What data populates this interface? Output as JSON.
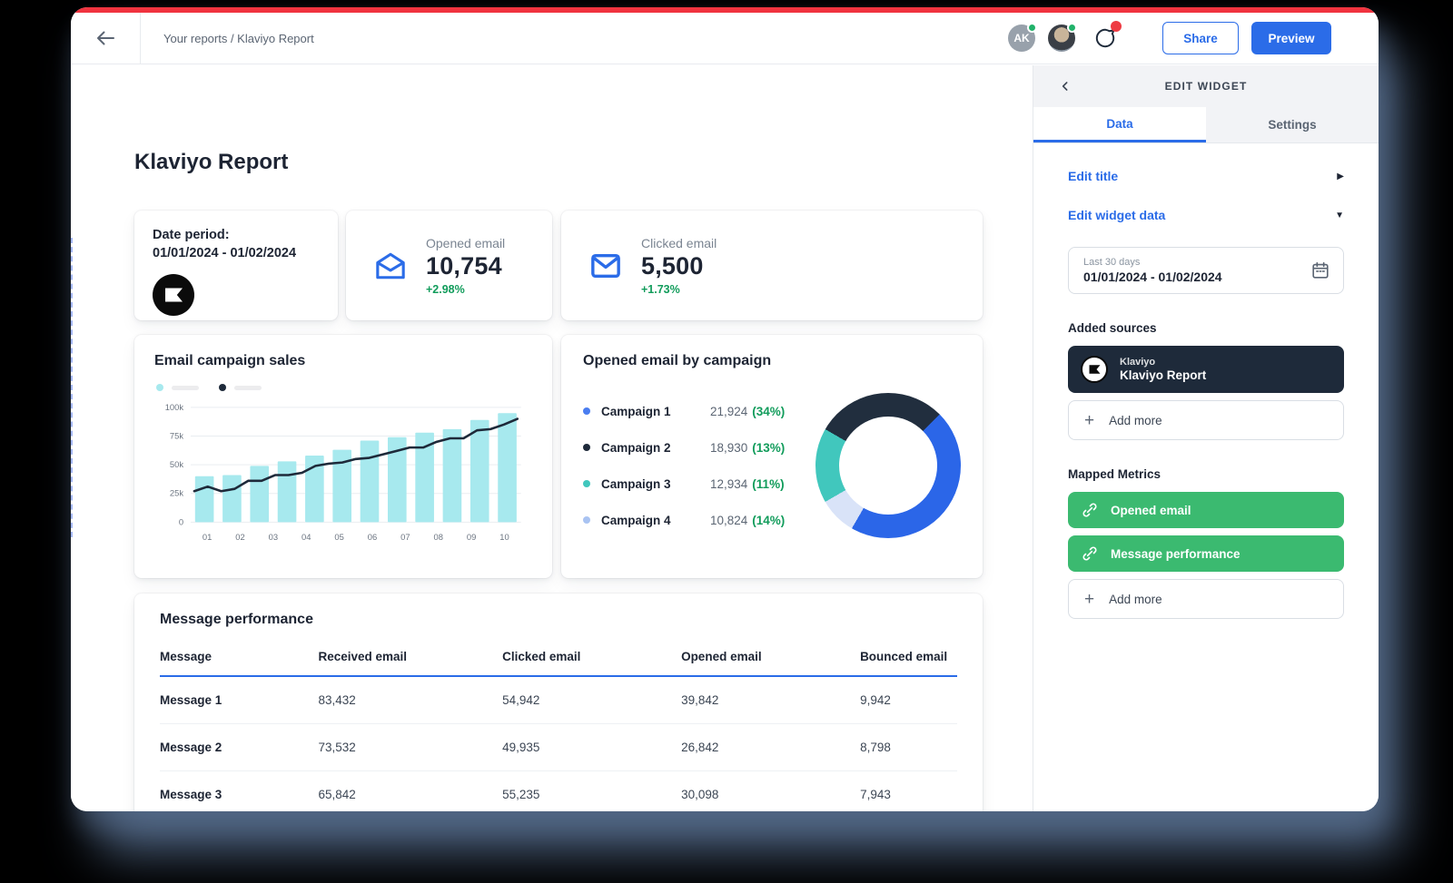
{
  "topbar": {
    "breadcrumb": "Your reports / Klaviyo Report",
    "avatar_initials": "AK",
    "share_label": "Share",
    "preview_label": "Preview"
  },
  "report": {
    "title": "Klaviyo Report",
    "date_card": {
      "label": "Date period:",
      "range": "01/01/2024 - 01/02/2024"
    },
    "kpis": [
      {
        "label": "Opened email",
        "value": "10,754",
        "delta": "+2.98%"
      },
      {
        "label": "Clicked email",
        "value": "5,500",
        "delta": "+1.73%"
      }
    ]
  },
  "chart_data": [
    {
      "type": "bar",
      "title": "Email campaign sales",
      "x_labels": [
        "01",
        "02",
        "03",
        "04",
        "05",
        "06",
        "07",
        "08",
        "09",
        "10"
      ],
      "bar_values_k": [
        40,
        41,
        49,
        53,
        58,
        63,
        71,
        74,
        78,
        81,
        89,
        95
      ],
      "line_values_k": [
        27,
        31,
        27,
        29,
        36,
        36,
        41,
        41,
        43,
        49,
        51,
        52,
        55,
        56,
        59,
        62,
        65,
        65,
        70,
        73,
        73,
        80,
        81,
        85,
        90
      ],
      "y_ticks": [
        "100k",
        "75k",
        "50k",
        "25k",
        "0"
      ],
      "ylim": [
        0,
        100
      ],
      "ylabel": "",
      "xlabel": "",
      "grid": "horizontal",
      "legend_position": "top-left-unlabeled",
      "bar_color": "#a7e9ee",
      "line_color": "#1e2a3a"
    },
    {
      "type": "pie",
      "title": "Opened email by campaign",
      "segments": [
        {
          "label": "Campaign 1",
          "value": "21,924",
          "pct": "(34%)",
          "dot_color": "#4a7df0"
        },
        {
          "label": "Campaign 2",
          "value": "18,930",
          "pct": "(13%)",
          "dot_color": "#1e2a3a"
        },
        {
          "label": "Campaign 3",
          "value": "12,934",
          "pct": "(11%)",
          "dot_color": "#41c7bd"
        },
        {
          "label": "Campaign 4",
          "value": "10,824",
          "pct": "(14%)",
          "dot_color": "#a9c3f2"
        }
      ],
      "donut": {
        "start_deg": 45,
        "arcs": [
          {
            "label": "Campaign 1",
            "color": "#2b66e8",
            "deg": 165
          },
          {
            "label": "Campaign 4",
            "color": "#d9e3f8",
            "deg": 30
          },
          {
            "label": "Campaign 3",
            "color": "#41c7bd",
            "deg": 60
          },
          {
            "label": "Campaign 2",
            "color": "#212e3e",
            "deg": 105
          }
        ]
      }
    }
  ],
  "table": {
    "title": "Message performance",
    "columns": [
      "Message",
      "Received email",
      "Clicked email",
      "Opened email",
      "Bounced email"
    ],
    "rows": [
      [
        "Message 1",
        "83,432",
        "54,942",
        "39,842",
        "9,942"
      ],
      [
        "Message 2",
        "73,532",
        "49,935",
        "26,842",
        "8,798"
      ],
      [
        "Message 3",
        "65,842",
        "55,235",
        "30,098",
        "7,943"
      ]
    ]
  },
  "sidebar": {
    "header": "EDIT WIDGET",
    "tabs": [
      {
        "label": "Data"
      },
      {
        "label": "Settings"
      }
    ],
    "edit_title_label": "Edit title",
    "edit_widget_data_label": "Edit widget data",
    "date_picker": {
      "preset": "Last 30 days",
      "range": "01/01/2024 - 01/02/2024"
    },
    "added_sources_label": "Added sources",
    "source": {
      "provider": "Klaviyo",
      "name": "Klaviyo Report"
    },
    "add_more_source_label": "Add more",
    "mapped_metrics_label": "Mapped Metrics",
    "metrics": [
      {
        "label": "Opened email"
      },
      {
        "label": "Message performance"
      }
    ],
    "add_more_metric_label": "Add more"
  },
  "colors": {
    "top_strip_red": "#f0333f",
    "primary_blue": "#2b6ce8",
    "metric_green": "#3bba70",
    "delta_green": "#119c5b",
    "navy": "#1e2a3a",
    "bar_cyan": "#a7e9ee"
  }
}
